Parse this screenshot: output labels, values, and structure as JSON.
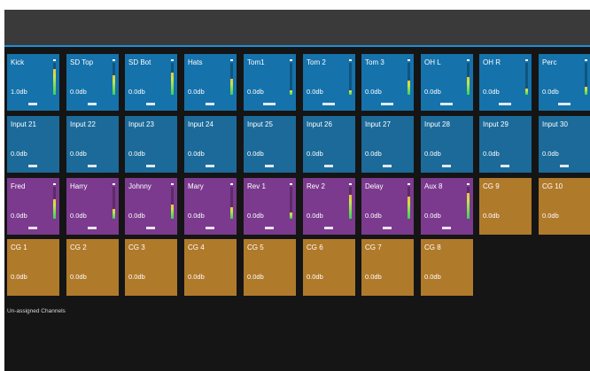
{
  "channels_row1": [
    {
      "name": "Kick",
      "gain": "1.0db",
      "meter": 0.8
    },
    {
      "name": "SD Top",
      "gain": "0.0db",
      "meter": 0.6
    },
    {
      "name": "SD Bot",
      "gain": "0.0db",
      "meter": 0.7
    },
    {
      "name": "Hats",
      "gain": "0.0db",
      "meter": 0.5
    },
    {
      "name": "Tom1",
      "gain": "0.0db",
      "meter": 0.15
    },
    {
      "name": "Tom 2",
      "gain": "0.0db",
      "meter": 0.15
    },
    {
      "name": "Tom 3",
      "gain": "0.0db",
      "meter": 0.45
    },
    {
      "name": "OH L",
      "gain": "0.0db",
      "meter": 0.55
    },
    {
      "name": "OH R",
      "gain": "0.0db",
      "meter": 0.2
    },
    {
      "name": "Perc",
      "gain": "0.0db",
      "meter": 0.25
    }
  ],
  "channels_row2": [
    {
      "name": "Input 21",
      "gain": "0.0db"
    },
    {
      "name": "Input 22",
      "gain": "0.0db"
    },
    {
      "name": "Input 23",
      "gain": "0.0db"
    },
    {
      "name": "Input 24",
      "gain": "0.0db"
    },
    {
      "name": "Input 25",
      "gain": "0.0db"
    },
    {
      "name": "Input 26",
      "gain": "0.0db"
    },
    {
      "name": "Input 27",
      "gain": "0.0db"
    },
    {
      "name": "Input 28",
      "gain": "0.0db"
    },
    {
      "name": "Input 29",
      "gain": "0.0db"
    },
    {
      "name": "Input 30",
      "gain": "0.0db"
    }
  ],
  "channels_row3": [
    {
      "name": "Fred",
      "gain": "0.0db",
      "meter": 0.6,
      "kind": "purple"
    },
    {
      "name": "Harry",
      "gain": "0.0db",
      "meter": 0.3,
      "kind": "purple"
    },
    {
      "name": "Johnny",
      "gain": "0.0db",
      "meter": 0.45,
      "kind": "purple"
    },
    {
      "name": "Mary",
      "gain": "0.0db",
      "meter": 0.35,
      "kind": "purple"
    },
    {
      "name": "Rev 1",
      "gain": "0.0db",
      "meter": 0.2,
      "kind": "purple"
    },
    {
      "name": "Rev 2",
      "gain": "0.0db",
      "meter": 0.75,
      "kind": "purple"
    },
    {
      "name": "Delay",
      "gain": "0.0db",
      "meter": 0.7,
      "kind": "purple"
    },
    {
      "name": "Aux 8",
      "gain": "0.0db",
      "meter": 0.8,
      "kind": "purple"
    },
    {
      "name": "CG 9",
      "gain": "0.0db",
      "kind": "gold"
    },
    {
      "name": "CG 10",
      "gain": "0.0db",
      "kind": "gold"
    }
  ],
  "channels_row4": [
    {
      "name": "CG 1",
      "gain": "0.0db"
    },
    {
      "name": "CG 2",
      "gain": "0.0db"
    },
    {
      "name": "CG 3",
      "gain": "0.0db"
    },
    {
      "name": "CG 4",
      "gain": "0.0db"
    },
    {
      "name": "CG 5",
      "gain": "0.0db"
    },
    {
      "name": "CG 6",
      "gain": "0.0db"
    },
    {
      "name": "CG 7",
      "gain": "0.0db"
    },
    {
      "name": "CG 8",
      "gain": "0.0db"
    }
  ],
  "unassigned_label": "Un-assigned Channels",
  "colors": {
    "blue": "#1572ab",
    "purple": "#7b3a8e",
    "gold": "#b07a2b",
    "accent": "#1e90d6"
  }
}
